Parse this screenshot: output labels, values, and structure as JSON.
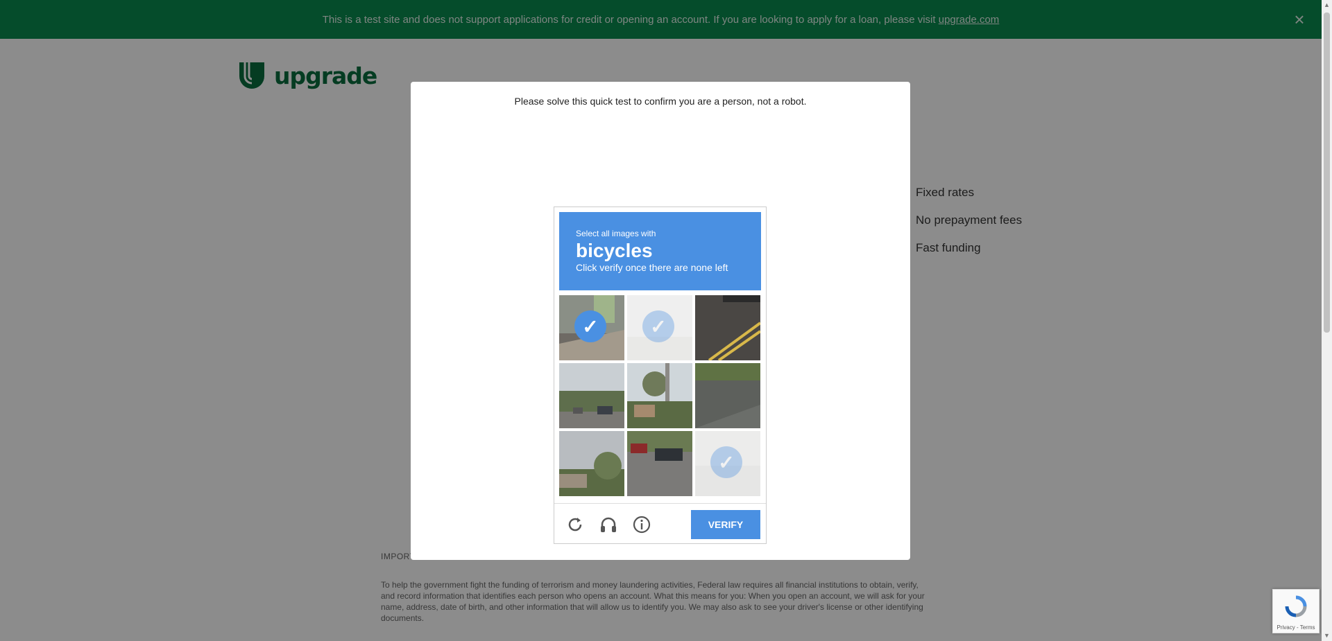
{
  "banner": {
    "text": "This is a test site and does not support applications for credit or opening an account. If you are looking to apply for a loan, please visit ",
    "link": "upgrade.com"
  },
  "logo": {
    "text": "upgrade"
  },
  "features": [
    "Fixed rates",
    "No prepayment fees",
    "Fast funding"
  ],
  "legal": {
    "heading": "IMPORT",
    "body": "To help the government fight the funding of terrorism and money laundering activities, Federal law requires all financial institutions to obtain, verify, and record information that identifies each person who opens an account. What this means for you: When you open an account, we will ask for your name, address, date of birth, and other information that will allow us to identify you. We may also ask to see your driver's license or other identifying documents."
  },
  "modal": {
    "message": "Please solve this quick test to confirm you are a person, not a robot."
  },
  "captcha": {
    "instruction": "Select all images with",
    "target": "bicycles",
    "hint": "Click verify once there are none left",
    "verify_label": "VERIFY",
    "tiles": [
      {
        "selected": true,
        "faded": false
      },
      {
        "selected": true,
        "faded": true
      },
      {
        "selected": false,
        "faded": false
      },
      {
        "selected": false,
        "faded": false
      },
      {
        "selected": false,
        "faded": false
      },
      {
        "selected": false,
        "faded": false
      },
      {
        "selected": false,
        "faded": false
      },
      {
        "selected": false,
        "faded": false
      },
      {
        "selected": true,
        "faded": true
      }
    ]
  },
  "recaptcha": {
    "links": "Privacy - Terms"
  },
  "colors": {
    "brand_green": "#0a8a4f",
    "captcha_blue": "#4a90e2"
  }
}
